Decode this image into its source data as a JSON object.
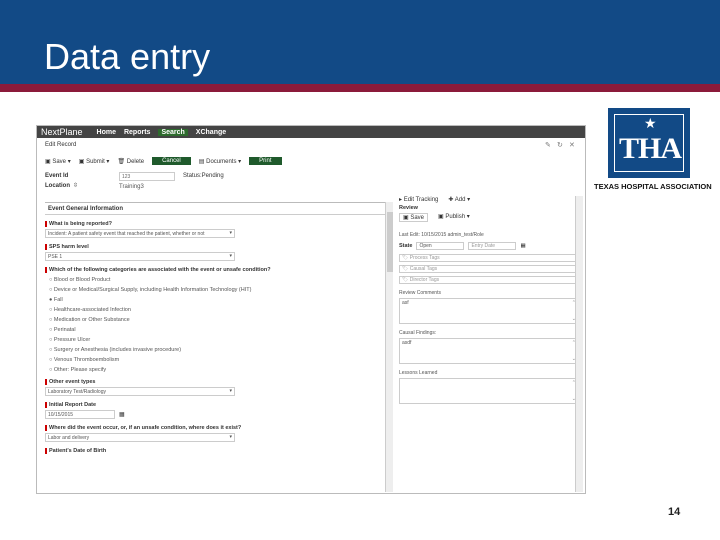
{
  "slide": {
    "title": "Data entry",
    "page_number": "14"
  },
  "logo": {
    "text": "THA",
    "caption": "TEXAS HOSPITAL ASSOCIATION"
  },
  "app": {
    "nav": {
      "logo": "NextPlane",
      "items": [
        "Home",
        "Reports",
        "Search",
        "XChange"
      ]
    },
    "record_title": "Edit Record",
    "toolbar": {
      "save": "Save",
      "submit": "Submit",
      "delete": "Delete",
      "cancel": "Cancel",
      "documents": "Documents",
      "print": "Print"
    },
    "event_id_label": "Event Id",
    "event_id_value": "123",
    "status_label": "Status:Pending",
    "location_label": "Location",
    "location_value": "Training3",
    "section_title": "Event General Information",
    "questions": {
      "q1": "What is being reported?",
      "q1_value": "Incident: A patient safety event that reached the patient, whether or not",
      "q2": "SPS harm level",
      "q2_value": "PSE 1",
      "q3": "Which of the following categories are associated with the event or unsafe condition?",
      "options": [
        "Blood or Blood Product",
        "Device or Medical/Surgical Supply, including Health Information Technology (HIT)",
        "Fall",
        "Healthcare-associated Infection",
        "Medication or Other Substance",
        "Perinatal",
        "Pressure Ulcer",
        "Surgery or Anesthesia (includes invasive procedure)",
        "Venous Thromboembolism",
        "Other: Please specify"
      ],
      "q4": "Other event types",
      "q4_value": "Laboratory Test/Radiology",
      "q5": "Initial Report Date",
      "q5_value": "10/15/2015",
      "q6": "Where did the event occur, or, if an unsafe condition, where does it exist?",
      "q6_value": "Labor and delivery",
      "q7": "Patient's Date of Birth"
    },
    "review": {
      "edit_tracking": "Edit Tracking",
      "add": "Add",
      "title": "Review",
      "save": "Save",
      "publish": "Publish",
      "last_edit": "Last Edit: 10/15/2015 admin_test/Role",
      "state_label": "State",
      "state_value": "Open",
      "date_placeholder": "Entry Date",
      "tags": [
        "Process Tags",
        "Causal Tags",
        "Director Tags"
      ],
      "review_comments_label": "Review Comments",
      "review_comments_value": "asf",
      "causal_findings_label": "Causal Findings:",
      "causal_findings_value": "asdf",
      "lessons_label": "Lessons Learned"
    }
  }
}
